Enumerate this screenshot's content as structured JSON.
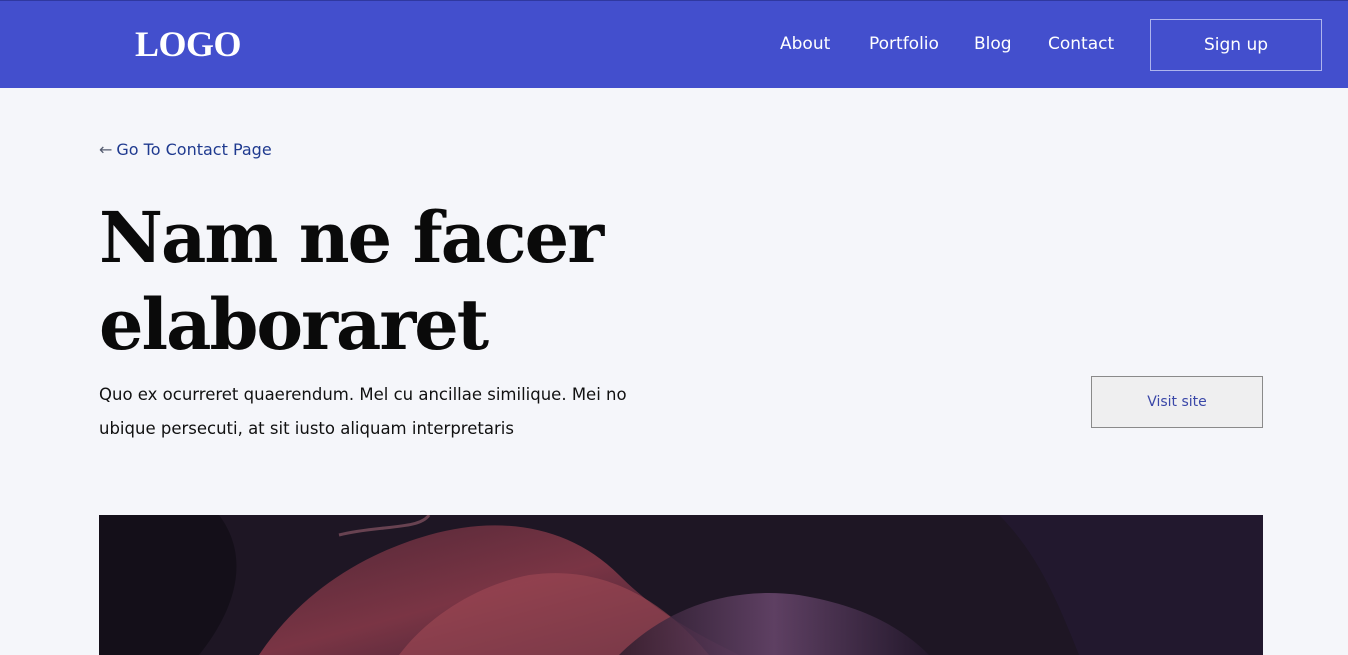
{
  "header": {
    "logo": "LOGO",
    "nav": [
      "About",
      "Portfolio",
      "Blog",
      "Contact"
    ],
    "signup_label": "Sign up",
    "background_color": "#434fcd"
  },
  "main": {
    "back_link": "Go To Contact Page",
    "title": "Nam ne facer elaboraret",
    "description": "Quo ex ocurreret quaerendum. Mel cu ancillae similique. Mei no ubique persecuti, at sit iusto aliquam interpretaris",
    "visit_label": "Visit site"
  }
}
